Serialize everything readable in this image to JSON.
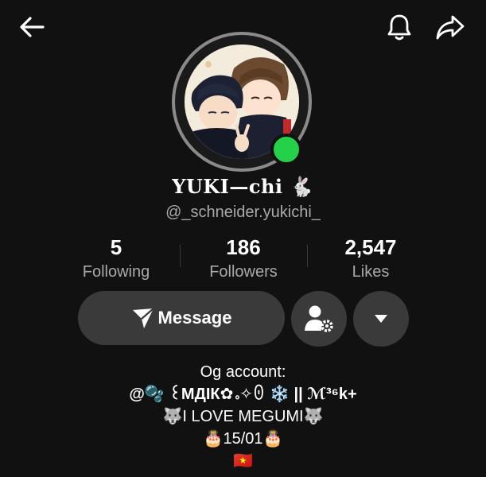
{
  "header": {
    "back_icon": "arrow-left-icon",
    "notification_icon": "bell-icon",
    "share_icon": "share-arrow-icon"
  },
  "profile": {
    "display_name": "YUKI—chi 🐇",
    "username": "@_schneider.yukichi_",
    "online_status_color": "#26d14a"
  },
  "stats": [
    {
      "value": "5",
      "label": "Following"
    },
    {
      "value": "186",
      "label": "Followers"
    },
    {
      "value": "2,547",
      "label": "Likes"
    }
  ],
  "actions": {
    "message_label": "Message",
    "message_icon": "send-icon",
    "follow_settings_icon": "user-gear-icon",
    "dropdown_icon": "caret-down-icon"
  },
  "bio": [
    "Og account:",
    "@🫧 ꒰МДІК✿｡✧ꏿ ❄️ || ℳ³⁶k+",
    "🐺I LOVE MEGUMI🐺",
    "🎂15/01🎂",
    "🇻🇳"
  ]
}
